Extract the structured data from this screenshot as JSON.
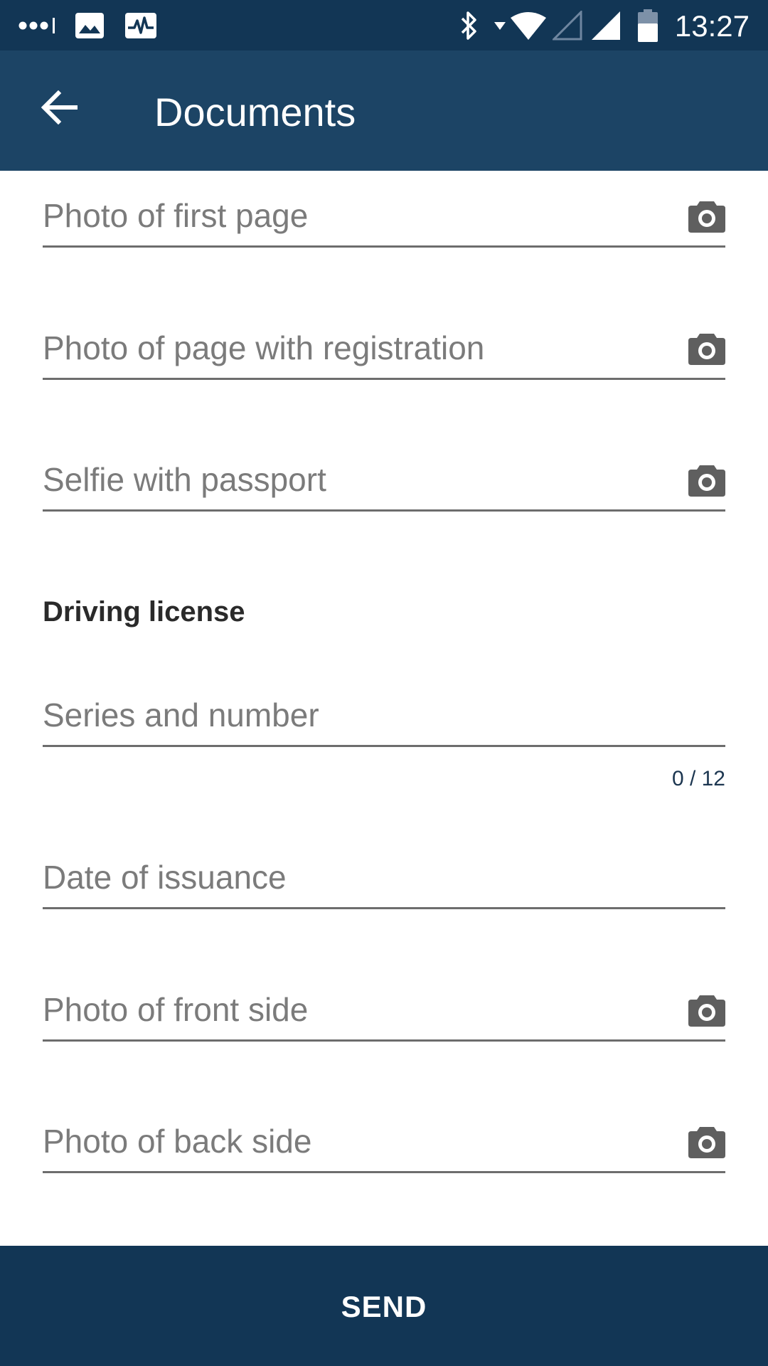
{
  "status_bar": {
    "time": "13:27",
    "icons": [
      "more-dots-icon",
      "image-icon",
      "activity-icon",
      "bluetooth-icon",
      "wifi-icon",
      "signal-empty-icon",
      "signal-full-icon",
      "battery-icon"
    ]
  },
  "app_bar": {
    "title": "Documents",
    "back_icon": "arrow-back-icon"
  },
  "passport_fields": [
    {
      "placeholder": "Photo of first page",
      "value": "",
      "icon": "camera-icon"
    },
    {
      "placeholder": "Photo of page with registration",
      "value": "",
      "icon": "camera-icon"
    },
    {
      "placeholder": "Selfie with passport",
      "value": "",
      "icon": "camera-icon"
    }
  ],
  "driving_license": {
    "section_title": "Driving license",
    "series_number": {
      "placeholder": "Series and number",
      "value": "",
      "counter": "0 / 12"
    },
    "date_of_issuance": {
      "placeholder": "Date of issuance",
      "value": ""
    },
    "front_side": {
      "placeholder": "Photo of front side",
      "value": "",
      "icon": "camera-icon"
    },
    "back_side": {
      "placeholder": "Photo of back side",
      "value": "",
      "icon": "camera-icon"
    }
  },
  "footer": {
    "send_label": "SEND"
  },
  "colors": {
    "status_bar": "#123655",
    "app_bar": "#1c4465",
    "send_button": "#123655",
    "field_underline": "#6d6d6d",
    "placeholder": "#7b7b7b",
    "icon": "#5f5f5f"
  }
}
